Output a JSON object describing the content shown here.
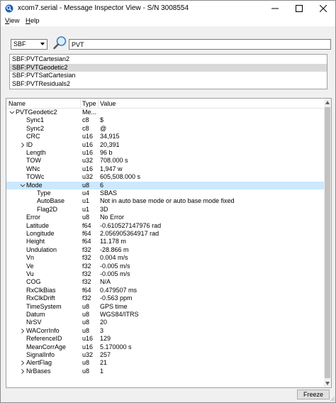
{
  "window": {
    "title": "xcom7.serial - Message Inspector View - S/N 3008554"
  },
  "menu": {
    "view_label": "View",
    "view_key": "V",
    "view_rest": "iew",
    "help_label": "Help",
    "help_key": "H",
    "help_rest": "elp"
  },
  "filter": {
    "type_selected": "SBF",
    "search_value": "PVT"
  },
  "block_list": {
    "items": [
      "SBF:PVTCartesian2",
      "SBF:PVTGeodetic2",
      "SBF:PVTSatCartesian",
      "SBF:PVTResiduals2"
    ],
    "selected_index": 1
  },
  "tree": {
    "columns": [
      "Name",
      "Type",
      "Value"
    ],
    "rows": [
      {
        "name": "PVTGeodetic2",
        "type": "Me...",
        "value": "",
        "level": 0,
        "expander": "expanded"
      },
      {
        "name": "Sync1",
        "type": "c8",
        "value": "$",
        "level": 1,
        "expander": ""
      },
      {
        "name": "Sync2",
        "type": "c8",
        "value": "@",
        "level": 1,
        "expander": ""
      },
      {
        "name": "CRC",
        "type": "u16",
        "value": "34,915",
        "level": 1,
        "expander": ""
      },
      {
        "name": "ID",
        "type": "u16",
        "value": "20,391",
        "level": 1,
        "expander": "collapsed"
      },
      {
        "name": "Length",
        "type": "u16",
        "value": "96 b",
        "level": 1,
        "expander": ""
      },
      {
        "name": "TOW",
        "type": "u32",
        "value": "708.000 s",
        "level": 1,
        "expander": ""
      },
      {
        "name": "WNc",
        "type": "u16",
        "value": "1,947 w",
        "level": 1,
        "expander": ""
      },
      {
        "name": "TOWc",
        "type": "u32",
        "value": "605,508.000 s",
        "level": 1,
        "expander": ""
      },
      {
        "name": "Mode",
        "type": "u8",
        "value": "6",
        "level": 1,
        "expander": "expanded",
        "selected": true
      },
      {
        "name": "Type",
        "type": "u4",
        "value": "SBAS",
        "level": 2,
        "expander": ""
      },
      {
        "name": "AutoBase",
        "type": "u1",
        "value": "Not in auto base mode or auto base mode fixed",
        "level": 2,
        "expander": ""
      },
      {
        "name": "Flag2D",
        "type": "u1",
        "value": "3D",
        "level": 2,
        "expander": ""
      },
      {
        "name": "Error",
        "type": "u8",
        "value": "No Error",
        "level": 1,
        "expander": ""
      },
      {
        "name": "Latitude",
        "type": "f64",
        "value": "-0.610527147976 rad",
        "level": 1,
        "expander": ""
      },
      {
        "name": "Longitude",
        "type": "f64",
        "value": "2.056905364917 rad",
        "level": 1,
        "expander": ""
      },
      {
        "name": "Height",
        "type": "f64",
        "value": "11.178 m",
        "level": 1,
        "expander": ""
      },
      {
        "name": "Undulation",
        "type": "f32",
        "value": "-28.866 m",
        "level": 1,
        "expander": ""
      },
      {
        "name": "Vn",
        "type": "f32",
        "value": "0.004 m/s",
        "level": 1,
        "expander": ""
      },
      {
        "name": "Ve",
        "type": "f32",
        "value": "-0.005 m/s",
        "level": 1,
        "expander": ""
      },
      {
        "name": "Vu",
        "type": "f32",
        "value": "-0.005 m/s",
        "level": 1,
        "expander": ""
      },
      {
        "name": "COG",
        "type": "f32",
        "value": "N/A",
        "level": 1,
        "expander": ""
      },
      {
        "name": "RxClkBias",
        "type": "f64",
        "value": "0.479507 ms",
        "level": 1,
        "expander": ""
      },
      {
        "name": "RxClkDrift",
        "type": "f32",
        "value": "-0.563 ppm",
        "level": 1,
        "expander": ""
      },
      {
        "name": "TimeSystem",
        "type": "u8",
        "value": "GPS time",
        "level": 1,
        "expander": ""
      },
      {
        "name": "Datum",
        "type": "u8",
        "value": "WGS84/ITRS",
        "level": 1,
        "expander": ""
      },
      {
        "name": "NrSV",
        "type": "u8",
        "value": "20",
        "level": 1,
        "expander": ""
      },
      {
        "name": "WACorrInfo",
        "type": "u8",
        "value": "3",
        "level": 1,
        "expander": "collapsed"
      },
      {
        "name": "ReferenceID",
        "type": "u16",
        "value": "129",
        "level": 1,
        "expander": ""
      },
      {
        "name": "MeanCorrAge",
        "type": "u16",
        "value": "5.170000 s",
        "level": 1,
        "expander": ""
      },
      {
        "name": "SignalInfo",
        "type": "u32",
        "value": "257",
        "level": 1,
        "expander": ""
      },
      {
        "name": "AlertFlag",
        "type": "u8",
        "value": "21",
        "level": 1,
        "expander": "collapsed"
      },
      {
        "name": "NrBases",
        "type": "u8",
        "value": "1",
        "level": 1,
        "expander": "collapsed"
      }
    ]
  },
  "footer": {
    "freeze_label": "Freeze"
  },
  "colors": {
    "selection_list": "#d9d9d9",
    "selection_tree": "#cce8ff",
    "chrome": "#f0f0f0"
  },
  "icons": {
    "app": "app-icon",
    "search": "search-icon",
    "minimize": "minimize-icon",
    "maximize": "maximize-icon",
    "close": "close-icon",
    "expanded": "chevron-down-icon",
    "collapsed": "chevron-right-icon"
  }
}
